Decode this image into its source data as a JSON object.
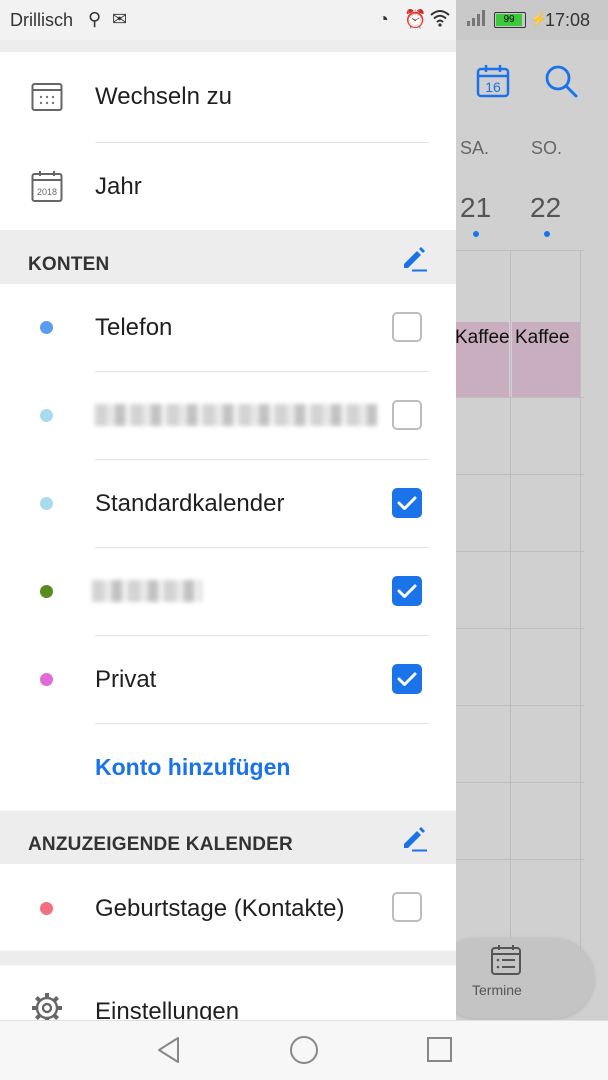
{
  "status_bar": {
    "carrier": "Drillisch",
    "battery": "99",
    "time": "17:08"
  },
  "drawer": {
    "top_items": [
      {
        "label": "Wechseln zu",
        "icon": "calendar-switch-icon"
      },
      {
        "label": "Jahr",
        "icon": "calendar-year-icon",
        "icon_text": "2018"
      }
    ],
    "konten": {
      "title": "KONTEN",
      "accounts": [
        {
          "label": "Telefon",
          "color": "#5b9cf0",
          "checked": false
        },
        {
          "label": "",
          "color": "#a8dcec",
          "checked": false,
          "redacted": true
        },
        {
          "label": "Standardkalender",
          "color": "#a8dcec",
          "checked": true
        },
        {
          "label": "",
          "color": "#5a8a1e",
          "checked": true,
          "redacted": true
        },
        {
          "label": "Privat",
          "color": "#e06ad8",
          "checked": true
        }
      ],
      "add_account": "Konto hinzufügen"
    },
    "anzuzeigende": {
      "title": "ANZUZEIGENDE KALENDER",
      "calendars": [
        {
          "label": "Geburtstage (Kontakte)",
          "color": "#f07080",
          "checked": false
        }
      ]
    },
    "settings_label": "Einstellungen"
  },
  "background": {
    "today_number": "16",
    "days": [
      {
        "name": "SA.",
        "number": "21"
      },
      {
        "name": "SO.",
        "number": "22"
      }
    ],
    "events": [
      "Kaffee",
      "Kaffee"
    ],
    "termine_label": "Termine"
  },
  "colors": {
    "accent": "#1a73e8"
  }
}
